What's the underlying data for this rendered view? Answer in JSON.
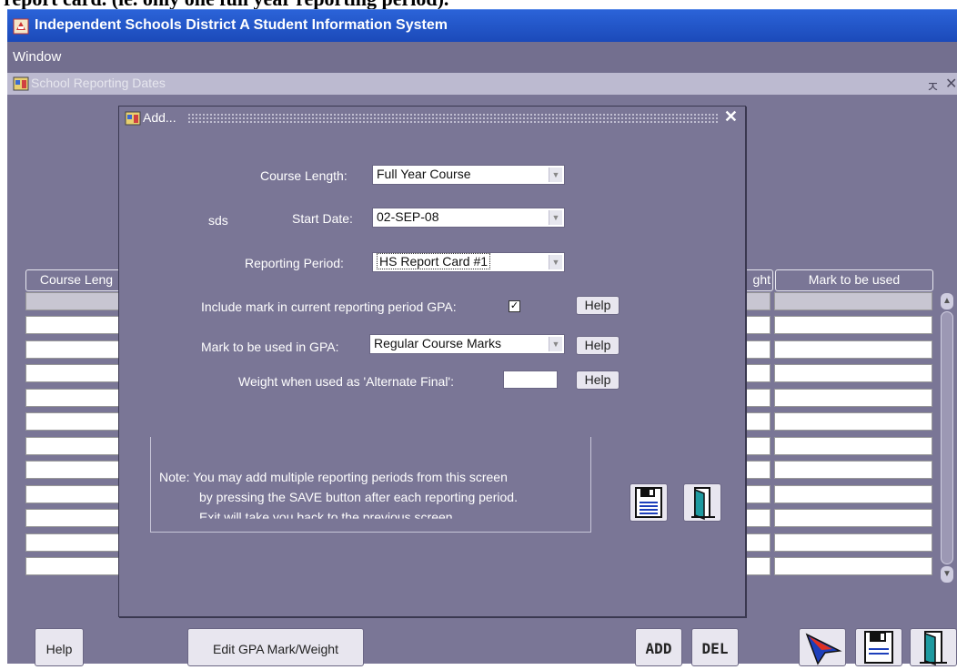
{
  "document": {
    "heading": "report card. (ie. only one full year reporting period)."
  },
  "app": {
    "title": "Independent Schools District A Student Information System",
    "menu": {
      "window": "Window"
    }
  },
  "inner_window": {
    "title": "School Reporting Dates",
    "controls": {
      "restore": "ㅈ",
      "close": "✕"
    }
  },
  "grid": {
    "headers": {
      "course_length": "Course Leng",
      "weight": "ght",
      "mark_used": "Mark to be used"
    },
    "row_count": 11
  },
  "dialog": {
    "title": "Add...",
    "close": "✕",
    "fields": {
      "course_length_label": "Course Length:",
      "course_length_value": "Full Year Course",
      "sds_label": "sds",
      "start_date_label": "Start Date:",
      "start_date_value": "02-SEP-08",
      "reporting_period_label": "Reporting Period:",
      "reporting_period_value": "HS Report Card #1",
      "include_mark_label": "Include mark in current reporting period GPA:",
      "include_mark_checked": true,
      "mark_gpa_label": "Mark to be used in GPA:",
      "mark_gpa_value": "Regular Course Marks",
      "weight_label": "Weight when used as 'Alternate Final':",
      "weight_value": "",
      "help": "Help"
    },
    "note": {
      "line1": "Note:  You may add multiple reporting periods from this screen",
      "line2": "by pressing the SAVE button after each reporting period.",
      "line3": "Exit will take you back to the previous screen."
    }
  },
  "bottom_bar": {
    "help": "Help",
    "edit_gpa": "Edit GPA Mark/Weight",
    "add": "ADD",
    "del": "DEL"
  },
  "colors": {
    "titlebar": "#1b49b8",
    "workspace": "#7a7696",
    "menubar": "#736f8f"
  },
  "icons": [
    "app-logo-icon",
    "window-icon",
    "save-icon",
    "exit-door-icon",
    "cursor-arrow-icon"
  ]
}
